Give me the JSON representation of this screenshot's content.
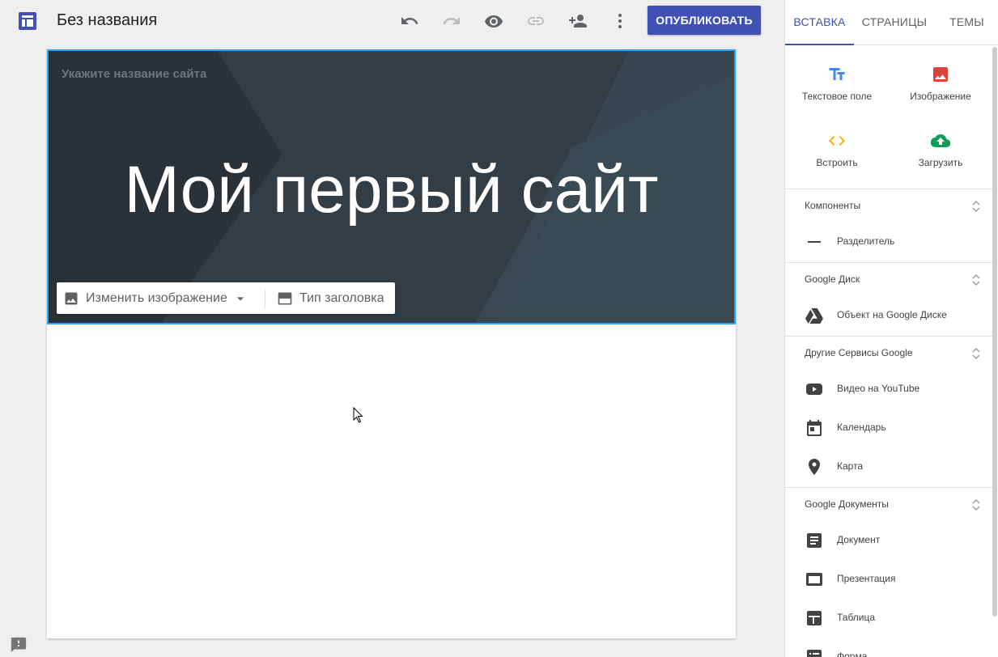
{
  "app": {
    "doc_title": "Без названия",
    "publish_label": "ОПУБЛИКОВАТЬ",
    "toolbar_icons": [
      "undo-icon",
      "redo-icon",
      "preview-icon",
      "link-icon",
      "share-icon",
      "more-icon"
    ]
  },
  "canvas": {
    "site_name_placeholder": "Укажите название сайта",
    "hero_title": "Мой первый сайт",
    "change_image_label": "Изменить изображение",
    "header_type_label": "Тип заголовка"
  },
  "panel": {
    "tabs": [
      {
        "label": "ВСТАВКА",
        "active": true
      },
      {
        "label": "СТРАНИЦЫ",
        "active": false
      },
      {
        "label": "ТЕМЫ",
        "active": false
      }
    ],
    "quick": [
      {
        "label": "Текстовое поле",
        "icon": "text-box-icon",
        "color": "#4285f4"
      },
      {
        "label": "Изображение",
        "icon": "image-icon",
        "color": "#db4437"
      },
      {
        "label": "Встроить",
        "icon": "embed-icon",
        "color": "#f4b400"
      },
      {
        "label": "Загрузить",
        "icon": "upload-icon",
        "color": "#0f9d58"
      }
    ],
    "sections": [
      {
        "title": "Компоненты",
        "items": [
          {
            "label": "Разделитель",
            "icon": "divider-icon"
          }
        ]
      },
      {
        "title": "Google Диск",
        "items": [
          {
            "label": "Объект на Google Диске",
            "icon": "drive-icon"
          }
        ]
      },
      {
        "title": "Другие Сервисы Google",
        "items": [
          {
            "label": "Видео на YouTube",
            "icon": "youtube-icon"
          },
          {
            "label": "Календарь",
            "icon": "calendar-icon"
          },
          {
            "label": "Карта",
            "icon": "map-pin-icon"
          }
        ]
      },
      {
        "title": "Google Документы",
        "items": [
          {
            "label": "Документ",
            "icon": "document-icon"
          },
          {
            "label": "Презентация",
            "icon": "slides-icon"
          },
          {
            "label": "Таблица",
            "icon": "sheets-icon"
          },
          {
            "label": "Форма",
            "icon": "forms-icon"
          }
        ]
      }
    ]
  },
  "colors": {
    "accent": "#3f51b5",
    "selection": "#2ea3f2",
    "header_bg": "#2f3a42"
  }
}
